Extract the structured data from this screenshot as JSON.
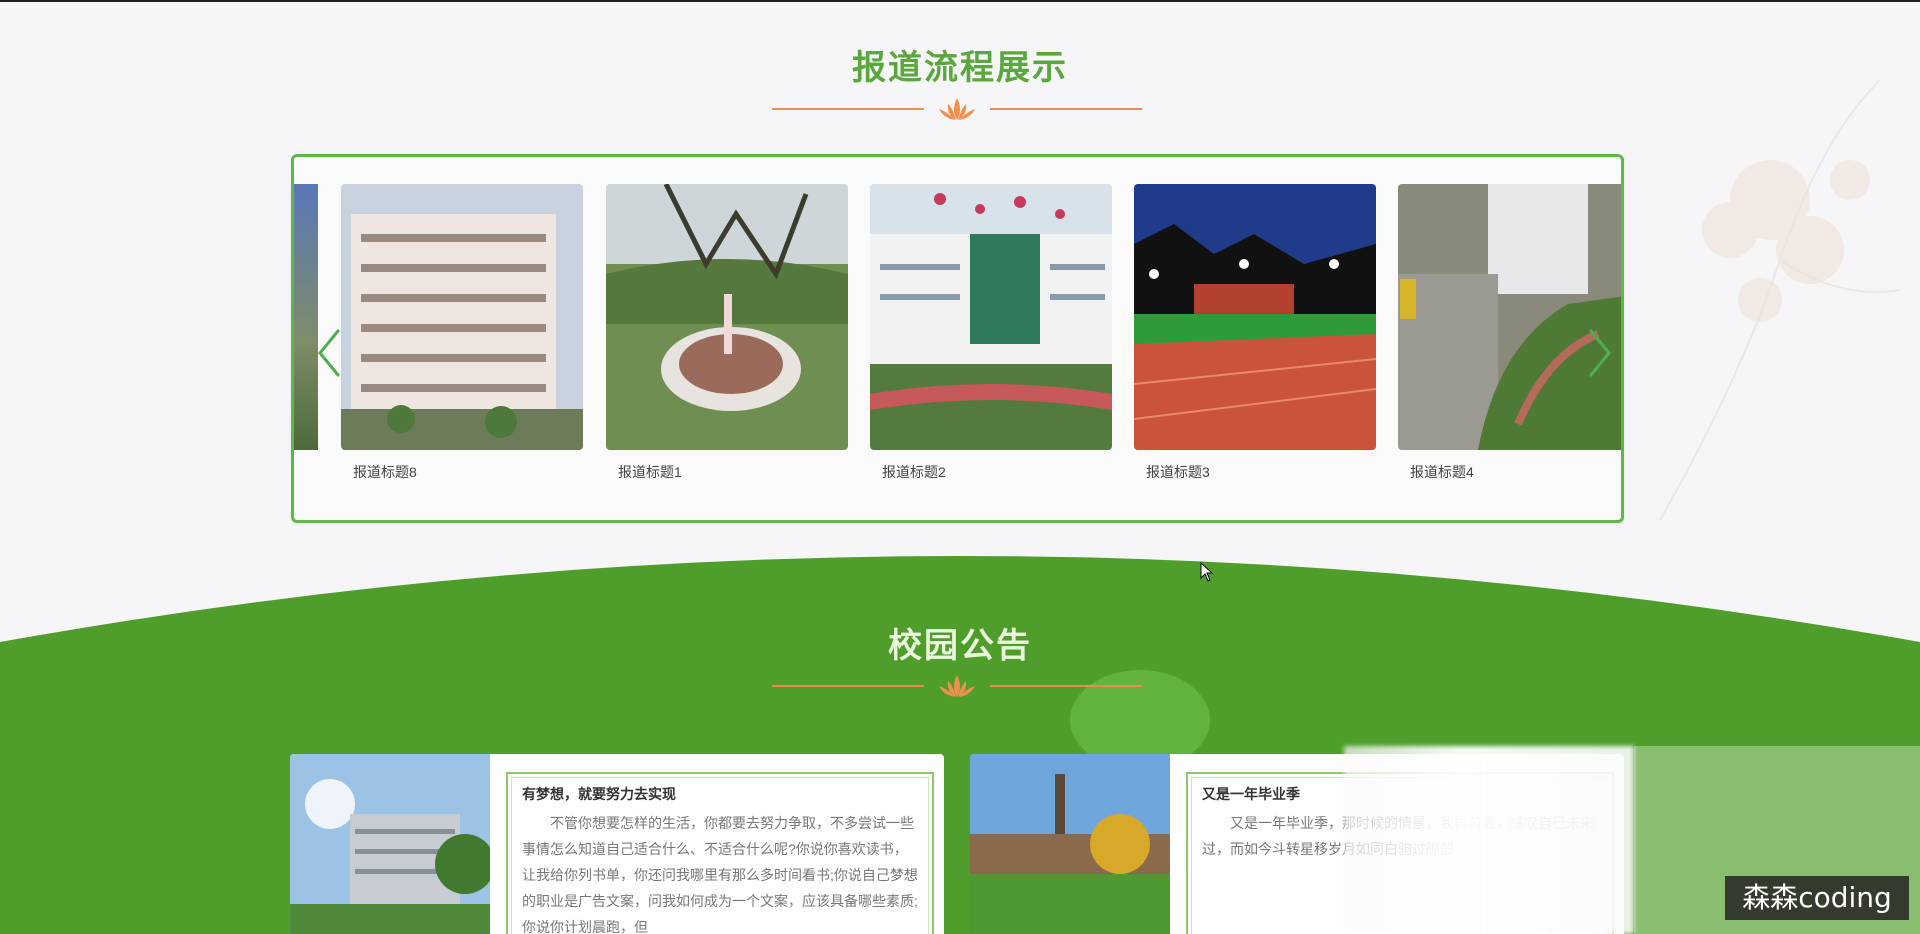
{
  "sections": {
    "flow": {
      "title": "报道流程展示"
    },
    "notice": {
      "title": "校园公告"
    }
  },
  "carousel": {
    "items": [
      {
        "caption": "报道标题8",
        "scene": "building"
      },
      {
        "caption": "报道标题1",
        "scene": "garden"
      },
      {
        "caption": "报道标题2",
        "scene": "campus"
      },
      {
        "caption": "报道标题3",
        "scene": "track"
      },
      {
        "caption": "报道标题4",
        "scene": "aerial"
      }
    ],
    "prev_icon": "chevron-left-icon",
    "next_icon": "chevron-right-icon"
  },
  "notices": [
    {
      "title": "有梦想，就要努力去实现",
      "body": "不管你想要怎样的生活，你都要去努力争取，不多尝试一些事情怎么知道自己适合什么、不适合什么呢?你说你喜欢读书，让我给你列书单，你还问我哪里有那么多时间看书;你说自己梦想的职业是广告文案，问我如何成为一个文案，应该具备哪些素质;你说你计划晨跑，但"
    },
    {
      "title": "又是一年毕业季",
      "body": "又是一年毕业季，那时候的情景，我再前面，感叹自己未来过，而如今斗转星移岁月如同白驹过隙般"
    }
  ],
  "watermark": "森森coding",
  "colors": {
    "accent_green": "#5db84a",
    "title_green": "#5aa83c",
    "divider_orange": "#f08a54",
    "wave_green": "#4f9e2c"
  }
}
